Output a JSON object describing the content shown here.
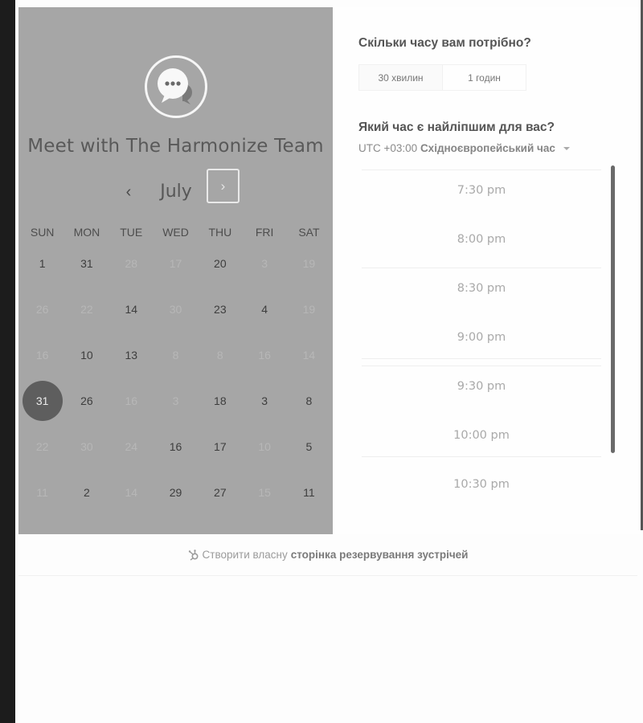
{
  "colors": {
    "calendar_bg": "#a6a6a6",
    "selected_day": "#5e5e5e",
    "panel_bg": "#fefefe",
    "scrollbar": "#6a6a6a"
  },
  "calendar": {
    "logo_icon": "chat-bubble-icon",
    "title": "Meet with The Harmonize Team",
    "month": "July",
    "prev_icon": "chevron-left-icon",
    "prev_label": "‹",
    "next_icon": "chevron-right-icon",
    "next_label": "›",
    "weekdays": [
      "SUN",
      "MON",
      "TUE",
      "WED",
      "THU",
      "FRI",
      "SAT"
    ],
    "weeks": [
      [
        {
          "d": "1",
          "s": "avail"
        },
        {
          "d": "31",
          "s": "avail"
        },
        {
          "d": "28",
          "s": "unavail"
        },
        {
          "d": "17",
          "s": "unavail"
        },
        {
          "d": "20",
          "s": "avail"
        },
        {
          "d": "3",
          "s": "unavail"
        },
        {
          "d": "19",
          "s": "unavail"
        }
      ],
      [
        {
          "d": "26",
          "s": "unavail"
        },
        {
          "d": "22",
          "s": "unavail"
        },
        {
          "d": "14",
          "s": "avail"
        },
        {
          "d": "30",
          "s": "unavail"
        },
        {
          "d": "23",
          "s": "avail"
        },
        {
          "d": "4",
          "s": "avail"
        },
        {
          "d": "19",
          "s": "unavail"
        }
      ],
      [
        {
          "d": "16",
          "s": "unavail"
        },
        {
          "d": "10",
          "s": "avail"
        },
        {
          "d": "13",
          "s": "avail"
        },
        {
          "d": "8",
          "s": "unavail"
        },
        {
          "d": "8",
          "s": "unavail"
        },
        {
          "d": "16",
          "s": "unavail"
        },
        {
          "d": "14",
          "s": "unavail"
        }
      ],
      [
        {
          "d": "31",
          "s": "selected"
        },
        {
          "d": "26",
          "s": "avail"
        },
        {
          "d": "16",
          "s": "unavail"
        },
        {
          "d": "3",
          "s": "unavail"
        },
        {
          "d": "18",
          "s": "avail"
        },
        {
          "d": "3",
          "s": "avail"
        },
        {
          "d": "8",
          "s": "avail"
        }
      ],
      [
        {
          "d": "22",
          "s": "unavail"
        },
        {
          "d": "30",
          "s": "unavail"
        },
        {
          "d": "24",
          "s": "unavail"
        },
        {
          "d": "16",
          "s": "avail"
        },
        {
          "d": "17",
          "s": "avail"
        },
        {
          "d": "10",
          "s": "unavail"
        },
        {
          "d": "5",
          "s": "avail"
        }
      ],
      [
        {
          "d": "11",
          "s": "unavail"
        },
        {
          "d": "2",
          "s": "avail"
        },
        {
          "d": "14",
          "s": "unavail"
        },
        {
          "d": "29",
          "s": "avail"
        },
        {
          "d": "27",
          "s": "avail"
        },
        {
          "d": "15",
          "s": "unavail"
        },
        {
          "d": "11",
          "s": "avail"
        }
      ]
    ]
  },
  "booking": {
    "duration_question": "Скільки часу вам потрібно?",
    "durations": [
      {
        "label": "30 хвилин",
        "active": true
      },
      {
        "label": "1 годин",
        "active": false
      }
    ],
    "time_question": "Який час є найліпшим для вас?",
    "timezone_offset": "UTC +03:00",
    "timezone_name": "Східноєвропейський час",
    "timezone_icon": "caret-down-icon",
    "slots": [
      "7:30 pm",
      "8:00 pm",
      "8:30 pm",
      "9:00 pm",
      "9:30 pm",
      "10:00 pm",
      "10:30 pm"
    ]
  },
  "footer": {
    "icon": "hubspot-sprocket-icon",
    "prefix": "Створити власну",
    "link": "сторінка резервування зустрічей"
  }
}
